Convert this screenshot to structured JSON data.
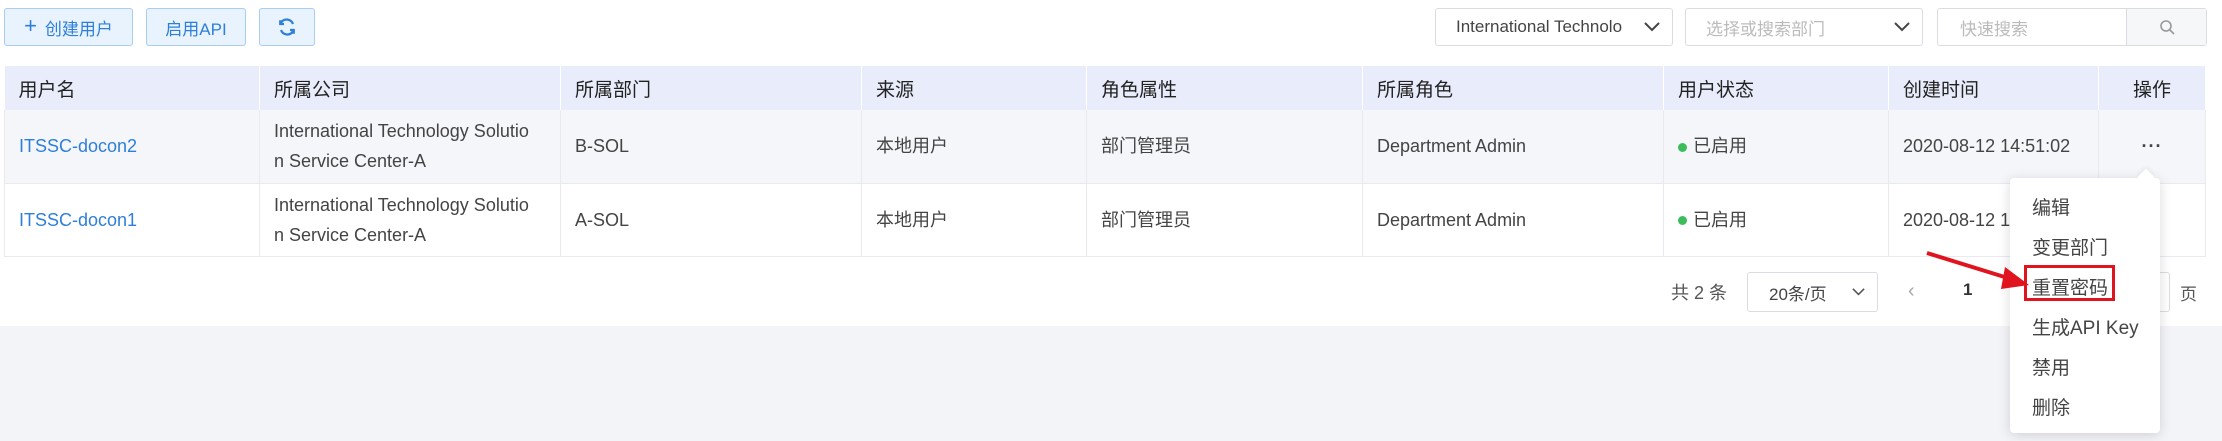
{
  "toolbar": {
    "create_user": "创建用户",
    "enable_api": "启用API",
    "company_select": "International Technolo",
    "dept_placeholder": "选择或搜索部门",
    "search_placeholder": "快速搜索"
  },
  "table": {
    "headers": [
      "用户名",
      "所属公司",
      "所属部门",
      "来源",
      "角色属性",
      "所属角色",
      "用户状态",
      "创建时间",
      "操作"
    ],
    "rows": [
      {
        "username": "ITSSC-docon2",
        "company_l1": "International Technology Solutio",
        "company_l2": "n Service Center-A",
        "dept": "B-SOL",
        "source": "本地用户",
        "role_attr": "部门管理员",
        "role": "Department Admin",
        "status": "已启用",
        "created": "2020-08-12 14:51:02",
        "action": "···"
      },
      {
        "username": "ITSSC-docon1",
        "company_l1": "International Technology Solutio",
        "company_l2": "n Service Center-A",
        "dept": "A-SOL",
        "source": "本地用户",
        "role_attr": "部门管理员",
        "role": "Department Admin",
        "status": "已启用",
        "created": "2020-08-12 1"
      }
    ]
  },
  "pagination": {
    "total": "共 2 条",
    "page_size": "20条/页",
    "current": "1",
    "page_suffix": "页"
  },
  "action_menu": {
    "items": [
      "编辑",
      "变更部门",
      "重置密码",
      "生成API Key",
      "禁用",
      "删除"
    ]
  },
  "colors": {
    "accent": "#2e7fd9",
    "highlight": "#e0141e",
    "status_enabled": "#3dbd5a"
  }
}
